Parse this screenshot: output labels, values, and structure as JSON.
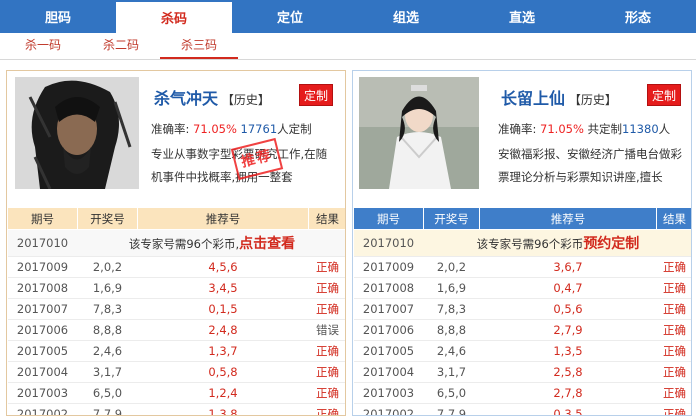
{
  "nav": {
    "tabs": [
      "胆码",
      "杀码",
      "定位",
      "组选",
      "直选",
      "形态"
    ],
    "active": 1
  },
  "subnav": {
    "tabs": [
      "杀一码",
      "杀二码",
      "杀三码"
    ],
    "active": 2
  },
  "headers": {
    "issue": "期号",
    "draw": "开奖号",
    "rec": "推荐号",
    "result": "结果"
  },
  "experts": [
    {
      "name": "杀气冲天",
      "history": "历史",
      "custom_label": "定制",
      "rate_label": "准确率:",
      "rate": "71.05%",
      "count": "17761",
      "count_suffix": "人定制",
      "desc": "专业从事数字型彩票研究工作,在随机事件中找概率,拥用一整套",
      "stamp": "推荐",
      "first_row": {
        "issue": "2017010",
        "note": "该专家号需96个彩币,",
        "link": "点击查看"
      },
      "rows": [
        {
          "issue": "2017009",
          "draw": "2,0,2",
          "rec": "4,5,6",
          "result": "正确"
        },
        {
          "issue": "2017008",
          "draw": "1,6,9",
          "rec": "3,4,5",
          "result": "正确"
        },
        {
          "issue": "2017007",
          "draw": "7,8,3",
          "rec": "0,1,5",
          "result": "正确"
        },
        {
          "issue": "2017006",
          "draw": "8,8,8",
          "rec": "2,4,8",
          "result": "错误"
        },
        {
          "issue": "2017005",
          "draw": "2,4,6",
          "rec": "1,3,7",
          "result": "正确"
        },
        {
          "issue": "2017004",
          "draw": "3,1,7",
          "rec": "0,5,8",
          "result": "正确"
        },
        {
          "issue": "2017003",
          "draw": "6,5,0",
          "rec": "1,2,4",
          "result": "正确"
        },
        {
          "issue": "2017002",
          "draw": "7,7,9",
          "rec": "1,3,8",
          "result": "正确"
        }
      ]
    },
    {
      "name": "长留上仙",
      "history": "历史",
      "custom_label": "定制",
      "rate_label": "准确率:",
      "rate": "71.05%",
      "count_prefix": "共定制",
      "count": "11380",
      "count_suffix": "人",
      "desc": "安徽福彩报、安徽经济广播电台做彩票理论分析与彩票知识讲座,擅长",
      "first_row": {
        "issue": "2017010",
        "note": "该专家号需96个彩币",
        "link": "预约定制"
      },
      "rows": [
        {
          "issue": "2017009",
          "draw": "2,0,2",
          "rec": "3,6,7",
          "result": "正确"
        },
        {
          "issue": "2017008",
          "draw": "1,6,9",
          "rec": "0,4,7",
          "result": "正确"
        },
        {
          "issue": "2017007",
          "draw": "7,8,3",
          "rec": "0,5,6",
          "result": "正确"
        },
        {
          "issue": "2017006",
          "draw": "8,8,8",
          "rec": "2,7,9",
          "result": "正确"
        },
        {
          "issue": "2017005",
          "draw": "2,4,6",
          "rec": "1,3,5",
          "result": "正确"
        },
        {
          "issue": "2017004",
          "draw": "3,1,7",
          "rec": "2,5,8",
          "result": "正确"
        },
        {
          "issue": "2017003",
          "draw": "6,5,0",
          "rec": "2,7,8",
          "result": "正确"
        },
        {
          "issue": "2017002",
          "draw": "7,7,9",
          "rec": "0,3,5",
          "result": "正确"
        }
      ]
    }
  ]
}
